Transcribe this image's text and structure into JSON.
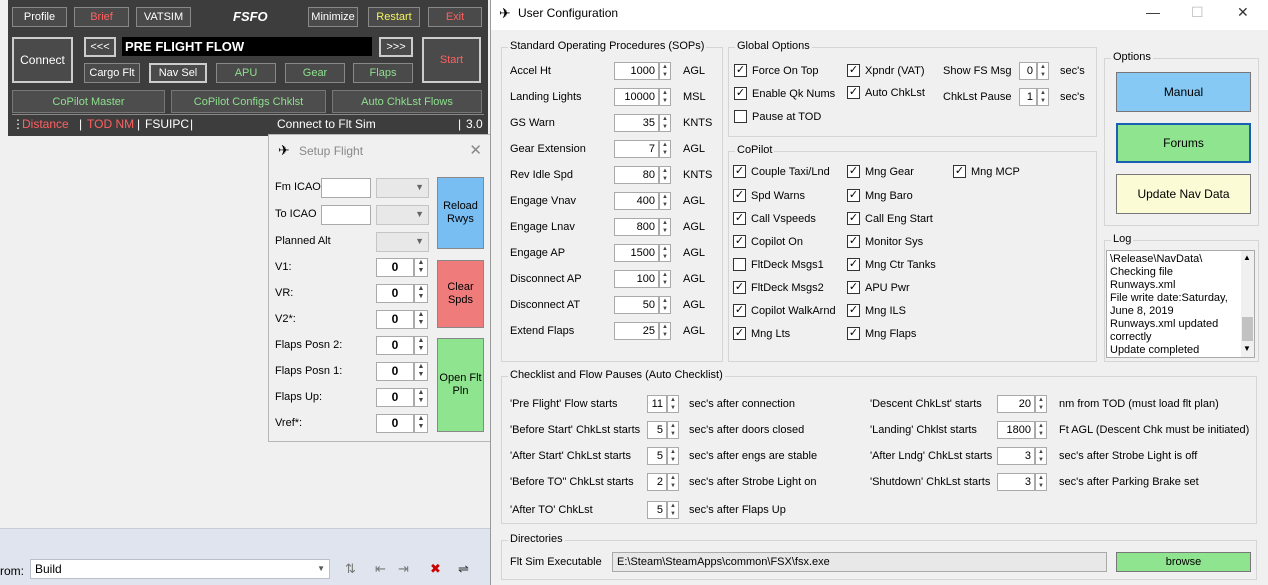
{
  "fsfo": {
    "title": "FSFO",
    "profile": "Profile",
    "brief": "Brief",
    "vatsim": "VATSIM",
    "minimize": "Minimize",
    "restart": "Restart",
    "exit": "Exit",
    "connect": "Connect",
    "prev": "<<<",
    "next": ">>>",
    "flow": "PRE FLIGHT FLOW",
    "start": "Start",
    "cargo": "Cargo Flt",
    "navsel": "Nav Sel",
    "apu": "APU",
    "gear": "Gear",
    "flaps": "Flaps",
    "copilot_master": "CoPilot Master",
    "copilot_configs": "CoPilot Configs Chklst",
    "auto_flows": "Auto ChkLst Flows",
    "status": {
      "distance": "Distance",
      "tod": "TOD NM",
      "fsuipc": "FSUIPC",
      "conn": "Connect to Flt Sim",
      "ver": "3.0"
    }
  },
  "setup": {
    "title": "Setup Flight",
    "fm_icao": "Fm ICAO",
    "to_icao": "To ICAO",
    "planned_alt": "Planned Alt",
    "v1": "V1:",
    "vr": "VR:",
    "v2": "V2*:",
    "flaps2": "Flaps Posn 2:",
    "flaps1": "Flaps Posn 1:",
    "flapsup": "Flaps Up:",
    "vref": "Vref*:",
    "v1_val": "0",
    "vr_val": "0",
    "v2_val": "0",
    "flaps2_val": "0",
    "flaps1_val": "0",
    "flapsup_val": "0",
    "vref_val": "0",
    "reload": "Reload Rwys",
    "clear": "Clear Spds",
    "open": "Open Flt Pln"
  },
  "ide": {
    "from_label": "rom:",
    "build": "Build"
  },
  "uc": {
    "title": "User Configuration",
    "sop_title": "Standard Operating Procedures (SOPs)",
    "sops": [
      {
        "label": "Accel Ht",
        "value": "1000",
        "unit": "AGL"
      },
      {
        "label": "Landing Lights",
        "value": "10000",
        "unit": "MSL"
      },
      {
        "label": "GS Warn",
        "value": "35",
        "unit": "KNTS"
      },
      {
        "label": "Gear Extension",
        "value": "7",
        "unit": "AGL"
      },
      {
        "label": "Rev Idle Spd",
        "value": "80",
        "unit": "KNTS"
      },
      {
        "label": "Engage Vnav",
        "value": "400",
        "unit": "AGL"
      },
      {
        "label": "Engage Lnav",
        "value": "800",
        "unit": "AGL"
      },
      {
        "label": "Engage AP",
        "value": "1500",
        "unit": "AGL"
      },
      {
        "label": "Disconnect AP",
        "value": "100",
        "unit": "AGL"
      },
      {
        "label": "Disconnect AT",
        "value": "50",
        "unit": "AGL"
      },
      {
        "label": "Extend Flaps",
        "value": "25",
        "unit": "AGL"
      }
    ],
    "global_title": "Global Options",
    "global": {
      "force_on_top": "Force On Top",
      "xpndr": "Xpndr (VAT)",
      "enable_qk": "Enable Qk Nums",
      "auto_chklst": "Auto ChkLst",
      "pause_tod": "Pause at TOD",
      "show_fs_msg": "Show FS Msg",
      "show_fs_val": "0",
      "chklst_pause": "ChkLst Pause",
      "chklst_pause_val": "1",
      "secs": "sec's"
    },
    "copilot_title": "CoPilot",
    "copilot": {
      "couple_taxi": "Couple Taxi/Lnd",
      "spd_warns": "Spd Warns",
      "call_vspeeds": "Call Vspeeds",
      "copilot_on": "Copilot On",
      "fltdeck1": "FltDeck Msgs1",
      "fltdeck2": "FltDeck Msgs2",
      "walkarnd": "Copilot WalkArnd",
      "mng_lts": "Mng Lts",
      "mng_gear": "Mng Gear",
      "mng_baro": "Mng Baro",
      "call_eng": "Call Eng Start",
      "monitor_sys": "Monitor Sys",
      "mng_ctr": "Mng Ctr Tanks",
      "apu_pwr": "APU Pwr",
      "mng_ils": "Mng ILS",
      "mng_flaps": "Mng Flaps",
      "mng_mcp": "Mng MCP"
    },
    "options_title": "Options",
    "manual": "Manual",
    "forums": "Forums",
    "update_nav": "Update Nav Data",
    "log_title": "Log",
    "log_lines": [
      "\\Release\\NavData\\",
      "Checking file Runways.xml",
      "File write date:Saturday, June 8, 2019",
      "Runways.xml updated correctly",
      "Update completed"
    ],
    "pauses_title": "Checklist and Flow Pauses (Auto Checklist)",
    "pauses_left": [
      {
        "label": "'Pre Flight' Flow starts",
        "value": "11",
        "suffix": "sec's after connection"
      },
      {
        "label": "'Before Start' ChkLst starts",
        "value": "5",
        "suffix": "sec's after doors closed"
      },
      {
        "label": "'After Start' ChkLst starts",
        "value": "5",
        "suffix": "sec's after engs are stable"
      },
      {
        "label": "'Before TO\" ChkLst starts",
        "value": "2",
        "suffix": "sec's after Strobe Light on"
      },
      {
        "label": "'After TO' ChkLst",
        "value": "5",
        "suffix": "sec's after Flaps Up"
      }
    ],
    "pauses_right": [
      {
        "label": "'Descent ChkLst' starts",
        "value": "20",
        "suffix": "nm from TOD (must load flt plan)"
      },
      {
        "label": "'Landing' Chklst starts",
        "value": "1800",
        "suffix": "Ft AGL (Descent Chk must be initiated)"
      },
      {
        "label": "'After Lndg' ChkLst starts",
        "value": "3",
        "suffix": "sec's after Strobe Light is off"
      },
      {
        "label": "'Shutdown' ChkLst starts",
        "value": "3",
        "suffix": "sec's after Parking Brake set"
      }
    ],
    "dirs_title": "Directories",
    "flt_sim_exe": "Flt Sim Executable",
    "exe_path": "E:\\Steam\\SteamApps\\common\\FSX\\fsx.exe",
    "browse": "browse"
  }
}
